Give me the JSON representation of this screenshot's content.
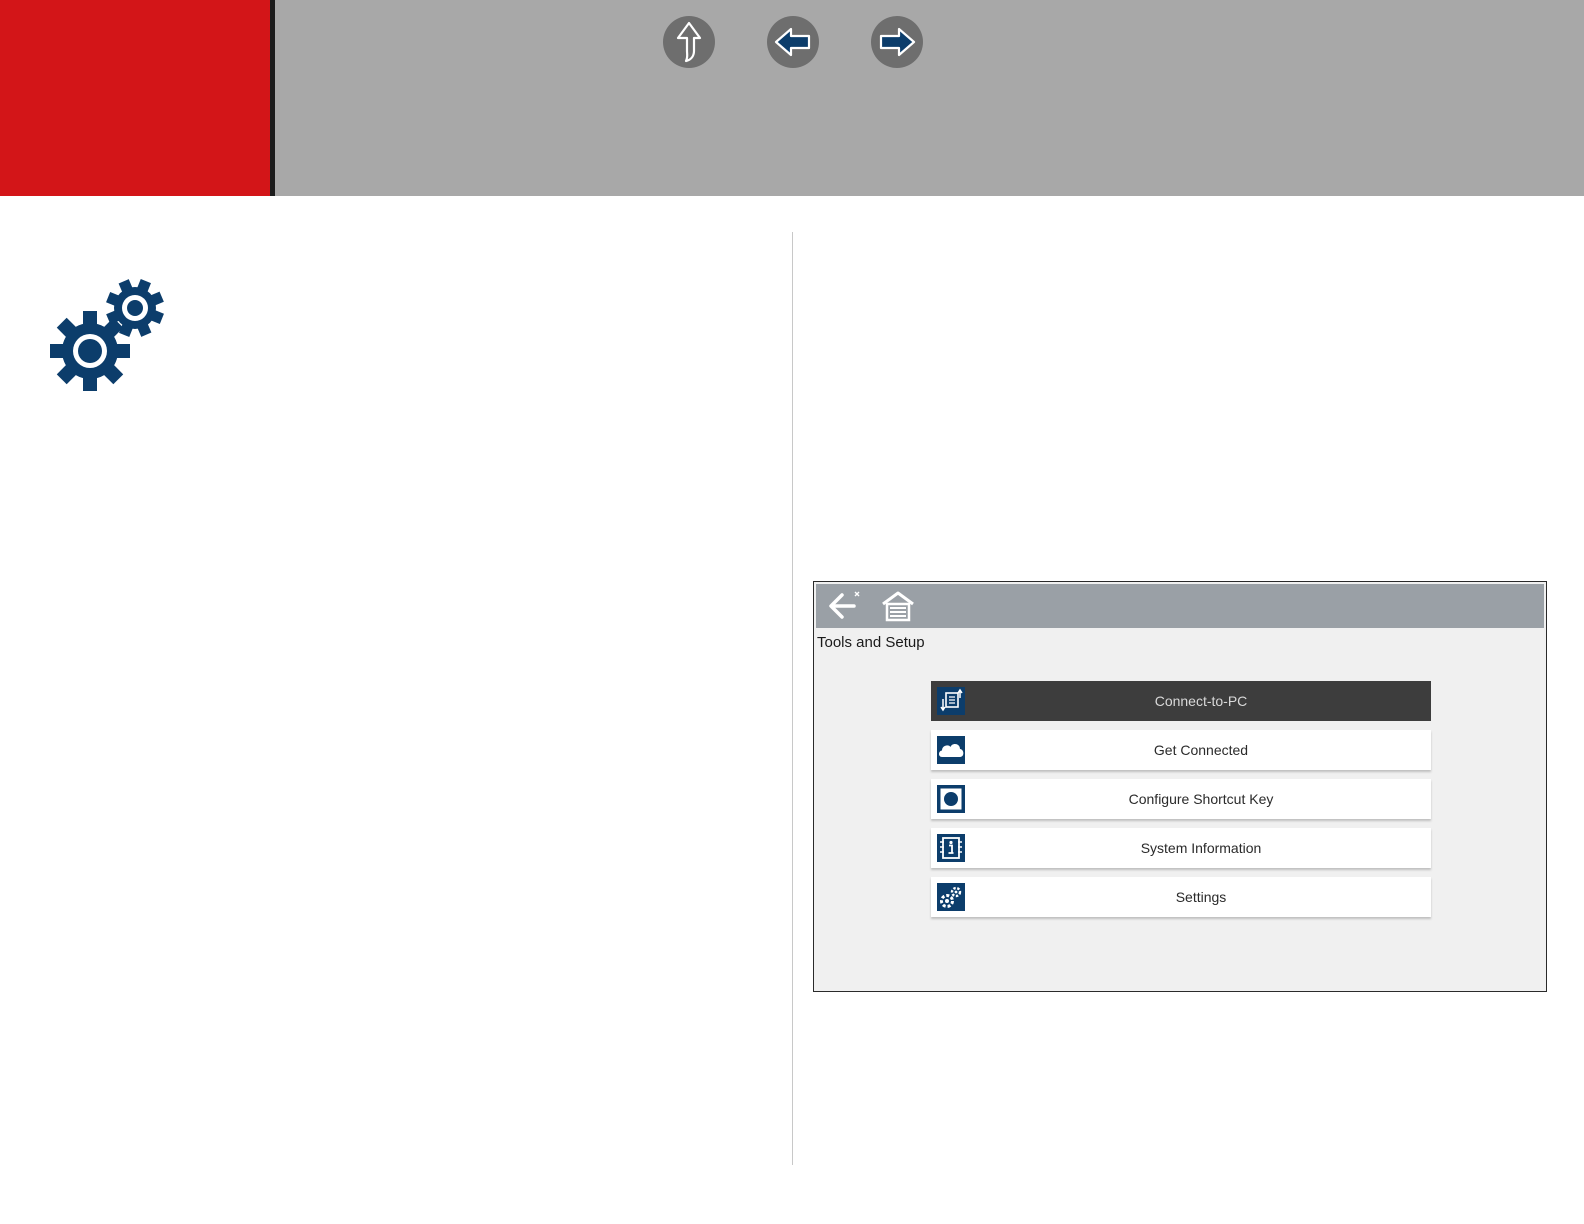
{
  "header": {
    "nav": {
      "up_label": "Up",
      "previous_label": "Previous",
      "next_label": "Next"
    }
  },
  "colors": {
    "header_red": "#d31518",
    "header_gray": "#a8a8a8",
    "icon_blue": "#0c3d6b",
    "active_row": "#3d3d3d"
  },
  "screen": {
    "title": "Tools and Setup",
    "toolbar_icons": [
      "back-icon",
      "home-icon"
    ],
    "menu": [
      {
        "label": "Connect-to-PC",
        "icon": "connect-to-pc-icon",
        "active": true
      },
      {
        "label": "Get Connected",
        "icon": "cloud-icon",
        "active": false
      },
      {
        "label": "Configure Shortcut Key",
        "icon": "shortcut-key-icon",
        "active": false
      },
      {
        "label": "System Information",
        "icon": "info-icon",
        "active": false
      },
      {
        "label": "Settings",
        "icon": "gears-icon",
        "active": false
      }
    ]
  }
}
